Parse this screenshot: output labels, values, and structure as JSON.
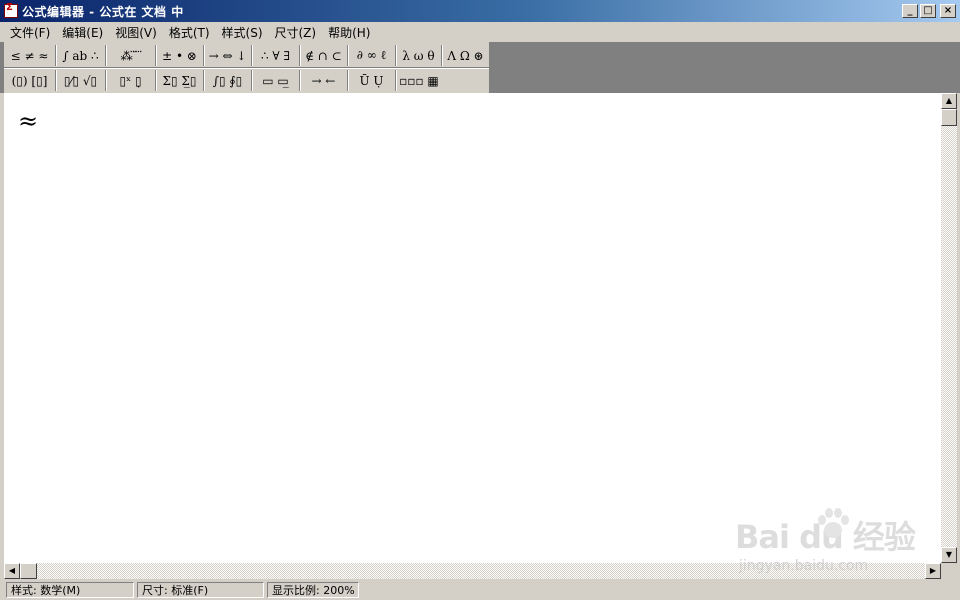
{
  "window": {
    "title": "公式编辑器 - 公式在 文档 中",
    "minimize": "_",
    "maximize": "□",
    "close": "×"
  },
  "menu": [
    {
      "label": "文件(F)"
    },
    {
      "label": "编辑(E)"
    },
    {
      "label": "视图(V)"
    },
    {
      "label": "格式(T)"
    },
    {
      "label": "样式(S)"
    },
    {
      "label": "尺寸(Z)"
    },
    {
      "label": "帮助(H)"
    }
  ],
  "toolbar": {
    "row1": [
      {
        "label": "≤ ≠ ≈",
        "icon": "relational-symbols-icon"
      },
      {
        "label": "∫ ab ∴",
        "icon": "spaces-ellipses-icon"
      },
      {
        "label": "⁂ ⃛ ⃜",
        "icon": "embellishments-icon"
      },
      {
        "label": "± • ⊗",
        "icon": "operator-symbols-icon"
      },
      {
        "label": "→ ⇔ ↓",
        "icon": "arrow-symbols-icon"
      },
      {
        "label": "∴ ∀ ∃",
        "icon": "logical-symbols-icon"
      },
      {
        "label": "∉ ∩ ⊂",
        "icon": "set-theory-symbols-icon"
      },
      {
        "label": "∂ ∞ ℓ",
        "icon": "miscellaneous-symbols-icon"
      },
      {
        "label": "λ ω θ",
        "icon": "greek-lowercase-icon"
      },
      {
        "label": "Λ Ω ⊛",
        "icon": "greek-uppercase-icon"
      }
    ],
    "row2": [
      {
        "label": "(▯) [▯]",
        "icon": "fence-templates-icon"
      },
      {
        "label": "▯⁄▯ √▯",
        "icon": "fraction-radical-templates-icon"
      },
      {
        "label": "▯ˣ ▯̣",
        "icon": "subscript-superscript-templates-icon"
      },
      {
        "label": "Σ▯ Σ̲▯",
        "icon": "summation-templates-icon"
      },
      {
        "label": "∫▯ ∮▯",
        "icon": "integral-templates-icon"
      },
      {
        "label": "▭ ▭̲",
        "icon": "underbar-overbar-templates-icon"
      },
      {
        "label": "→ ←",
        "icon": "labeled-arrow-templates-icon"
      },
      {
        "label": "Ū Ụ",
        "icon": "products-set-theory-templates-icon"
      },
      {
        "label": "▫▫▫ ▦",
        "icon": "matrix-templates-icon"
      }
    ]
  },
  "editor": {
    "formula": "≈"
  },
  "scroll": {
    "up": "▲",
    "down": "▼",
    "left": "◀",
    "right": "▶"
  },
  "status": {
    "style": "样式: 数学(M)",
    "size": "尺寸: 标准(F)",
    "zoom": "显示比例: 200%"
  },
  "watermark": {
    "brand": "Bai  du 经验",
    "url": "jingyan.baidu.com"
  }
}
